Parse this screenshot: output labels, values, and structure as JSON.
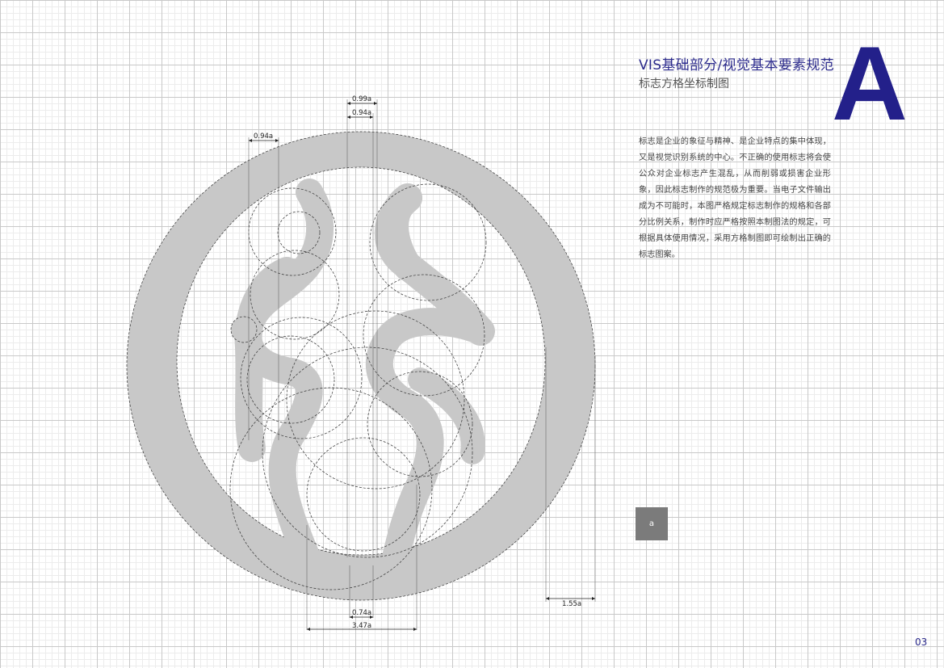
{
  "header": {
    "title": "VIS基础部分/视觉基本要素规范",
    "subtitle": "标志方格坐标制图",
    "section_letter": "A"
  },
  "description": "标志是企业的象征与精神、是企业特点的集中体现，又是视觉识别系统的中心。不正确的使用标志将会使公众对企业标志产生混乱，从而削弱或损害企业形象，因此标志制作的规范极为重要。当电子文件输出成为不可能时，本图严格规定标志制作的规格和各部分比例关系，制作时应严格按照本制图法的规定，可根据具体使用情况，采用方格制图即可绘制出正确的标志图案。",
  "unit_swatch": {
    "label": "a",
    "color": "#7b7b7b"
  },
  "dimensions": {
    "top_099": "0.99a",
    "top_094": "0.94a",
    "left_094": "0.94a",
    "bottom_074": "0.74a",
    "bottom_347": "3.47a",
    "right_155": "1.55a"
  },
  "colors": {
    "accent": "#23208a",
    "logo_gray": "#c8c8c8"
  },
  "page_number": "03"
}
